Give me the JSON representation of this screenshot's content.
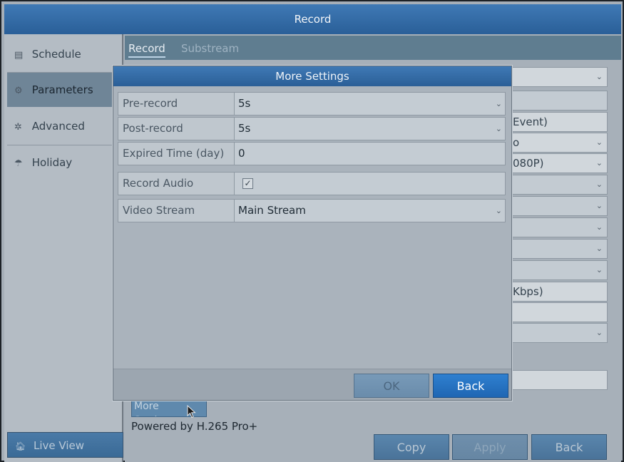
{
  "window": {
    "title": "Record"
  },
  "sidebar": {
    "items": [
      {
        "label": "Schedule",
        "icon": "calendar-icon",
        "glyph": "▤"
      },
      {
        "label": "Parameters",
        "icon": "gear-icon",
        "glyph": "⚙"
      },
      {
        "label": "Advanced",
        "icon": "gear-advanced-icon",
        "glyph": "✲"
      },
      {
        "label": "Holiday",
        "icon": "umbrella-icon",
        "glyph": "☂"
      }
    ],
    "live_view": {
      "label": "Live View",
      "icon": "home-icon",
      "glyph": "🏠︎"
    }
  },
  "tabs": [
    {
      "label": "Record"
    },
    {
      "label": "Substream"
    }
  ],
  "background_fields": {
    "f1": "",
    "f2": "",
    "f3": "Event)",
    "f4": "o",
    "f5": "080P)",
    "f6": "",
    "f7": "",
    "f8": "",
    "f9": "",
    "f10": "",
    "f11": "Kbps)",
    "f12": "",
    "f13": "",
    "f14": ""
  },
  "more_settings_button": {
    "label": "More Setting..."
  },
  "powered_by": "Powered by H.265 Pro+",
  "bottom_buttons": {
    "copy": "Copy",
    "apply": "Apply",
    "back": "Back"
  },
  "modal": {
    "title": "More Settings",
    "rows": [
      {
        "label": "Pre-record",
        "value": "5s"
      },
      {
        "label": "Post-record",
        "value": "5s"
      },
      {
        "label": "Expired Time (day)",
        "value": "0"
      },
      {
        "label": "Record Audio",
        "value": "✓"
      },
      {
        "label": "Video Stream",
        "value": "Main Stream"
      }
    ],
    "ok_label": "OK",
    "back_label": "Back"
  },
  "colors": {
    "accent": "#2f80d0",
    "titlebar": "#3f79b5"
  }
}
